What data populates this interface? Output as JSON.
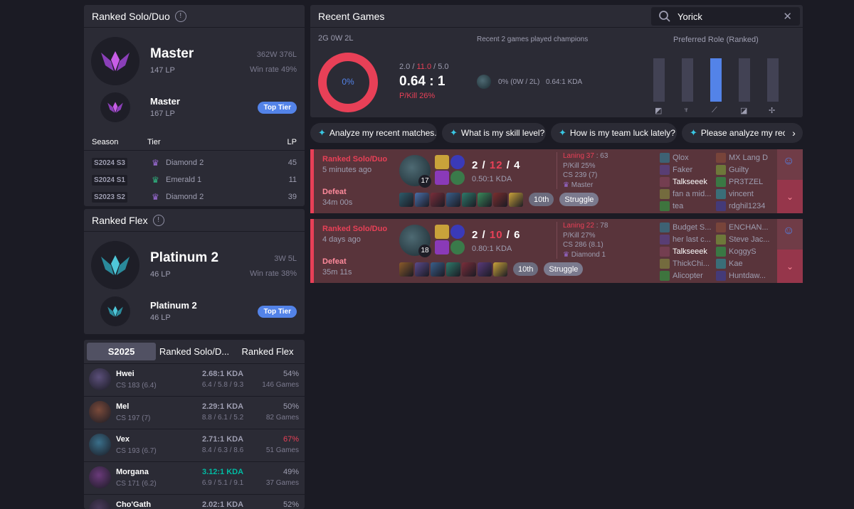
{
  "ranked_solo": {
    "title": "Ranked Solo/Duo",
    "current": {
      "tier": "Master",
      "lp": "147 LP",
      "wl": "362W 376L",
      "winrate": "Win rate 49%"
    },
    "peak": {
      "tier": "Master",
      "lp": "167 LP",
      "badge": "Top Tier"
    },
    "season_head": {
      "season": "Season",
      "tier": "Tier",
      "lp": "LP"
    },
    "seasons": [
      {
        "season": "S2024 S3",
        "tier": "Diamond 2",
        "lp": "45",
        "color": "#9b6bd6"
      },
      {
        "season": "S2024 S1",
        "tier": "Emerald 1",
        "lp": "11",
        "color": "#2fb37f"
      },
      {
        "season": "S2023 S2",
        "tier": "Diamond 2",
        "lp": "39",
        "color": "#9b6bd6"
      }
    ]
  },
  "ranked_flex": {
    "title": "Ranked Flex",
    "current": {
      "tier": "Platinum 2",
      "lp": "46 LP",
      "wl": "3W 5L",
      "winrate": "Win rate 38%"
    },
    "peak": {
      "tier": "Platinum 2",
      "lp": "46 LP",
      "badge": "Top Tier"
    }
  },
  "champ_tabs": [
    "S2025",
    "Ranked Solo/D...",
    "Ranked Flex"
  ],
  "champions": [
    {
      "name": "Hwei",
      "cs": "CS 183 (6.4)",
      "kda": "2.68:1 KDA",
      "breakdown": "6.4 / 5.8 / 9.3",
      "winrate": "54%",
      "games": "146 Games",
      "kda_color": "#9e9eb1",
      "wr_color": "#9e9eb1",
      "icon": "#5b4f7a"
    },
    {
      "name": "Mel",
      "cs": "CS 197 (7)",
      "kda": "2.29:1 KDA",
      "breakdown": "8.8 / 6.1 / 5.2",
      "winrate": "50%",
      "games": "82 Games",
      "kda_color": "#9e9eb1",
      "wr_color": "#9e9eb1",
      "icon": "#7a4a3a"
    },
    {
      "name": "Vex",
      "cs": "CS 193 (6.7)",
      "kda": "2.71:1 KDA",
      "breakdown": "8.4 / 6.3 / 8.6",
      "winrate": "67%",
      "games": "51 Games",
      "kda_color": "#9e9eb1",
      "wr_color": "#e84057",
      "icon": "#3a6f8a"
    },
    {
      "name": "Morgana",
      "cs": "CS 171 (6.2)",
      "kda": "3.12:1 KDA",
      "breakdown": "6.9 / 5.1 / 9.1",
      "winrate": "49%",
      "games": "37 Games",
      "kda_color": "#00bba3",
      "wr_color": "#9e9eb1",
      "icon": "#6a3a7a"
    },
    {
      "name": "Cho'Gath",
      "cs": "",
      "kda": "2.02:1 KDA",
      "breakdown": "",
      "winrate": "52%",
      "games": "",
      "kda_color": "#9e9eb1",
      "wr_color": "#9e9eb1",
      "icon": "#4a3a5a"
    }
  ],
  "recent": {
    "title": "Recent Games",
    "search_value": "Yorick",
    "summary": {
      "record": "2G 0W 2L",
      "winrate": "0%",
      "kills": "2.0",
      "deaths": "11.0",
      "assists": "5.0",
      "kda": "0.64 : 1",
      "pkill": "P/Kill 26%"
    },
    "played_title": "Recent 2 games played champions",
    "played": {
      "wr": "0% (0W / 2L)",
      "kda": "0.64:1 KDA"
    },
    "role_title": "Preferred Role (Ranked)",
    "roles": [
      {
        "name": "top-role-icon",
        "fraction": 0,
        "glyph": "◩"
      },
      {
        "name": "jungle-role-icon",
        "fraction": 0,
        "glyph": "♆"
      },
      {
        "name": "mid-role-icon",
        "fraction": 1,
        "glyph": "⟋"
      },
      {
        "name": "bot-role-icon",
        "fraction": 0,
        "glyph": "◪"
      },
      {
        "name": "support-role-icon",
        "fraction": 0,
        "glyph": "✢"
      }
    ]
  },
  "prompts": [
    "Analyze my recent matches.",
    "What is my skill level?",
    "How is my team luck lately?",
    "Please analyze my rece"
  ],
  "games": [
    {
      "type": "Ranked Solo/Duo",
      "time": "5 minutes ago",
      "result": "Defeat",
      "duration": "34m 00s",
      "level": "17",
      "k": "2",
      "d": "12",
      "a": "4",
      "kda": "0.50:1 KDA",
      "laning_label": "Laning 37",
      "laning_sep": ":",
      "laning_opp": "63",
      "pkill": "P/Kill 25%",
      "cs": "CS 239 (7)",
      "tier": "Master",
      "tag1": "10th",
      "tag2": "Struggle",
      "blue": [
        "Qlox",
        "Faker",
        "Talkseeek",
        "fan a mid...",
        "tea"
      ],
      "red": [
        "MX Lang D",
        "Guilty",
        "PR3TZEL",
        "vincent",
        "rdghil1234"
      ],
      "items": [
        "#2e5b6a",
        "#4a6fa8",
        "#7a2e3a",
        "#3a5f8a",
        "#2f7a6a",
        "#3a8a5a",
        "#7a2e2e",
        "#c9a23a"
      ]
    },
    {
      "type": "Ranked Solo/Duo",
      "time": "4 days ago",
      "result": "Defeat",
      "duration": "35m 11s",
      "level": "18",
      "k": "2",
      "d": "10",
      "a": "6",
      "kda": "0.80:1 KDA",
      "laning_label": "Laning 22",
      "laning_sep": ":",
      "laning_opp": "78",
      "pkill": "P/Kill 27%",
      "cs": "CS 286 (8.1)",
      "tier": "Diamond 1",
      "tag1": "10th",
      "tag2": "Struggle",
      "blue": [
        "Budget S...",
        "her last c...",
        "Talkseeek",
        "ThickChi...",
        "Alicopter"
      ],
      "red": [
        "ENCHAN...",
        "Steve Jac...",
        "KoggyS",
        "Kae",
        "Huntdaw..."
      ],
      "items": [
        "#8a5a2a",
        "#5a4a8a",
        "#3a5f8a",
        "#2f7a6a",
        "#7a2e3a",
        "#5a3a7a",
        "#c9a23a"
      ]
    }
  ]
}
